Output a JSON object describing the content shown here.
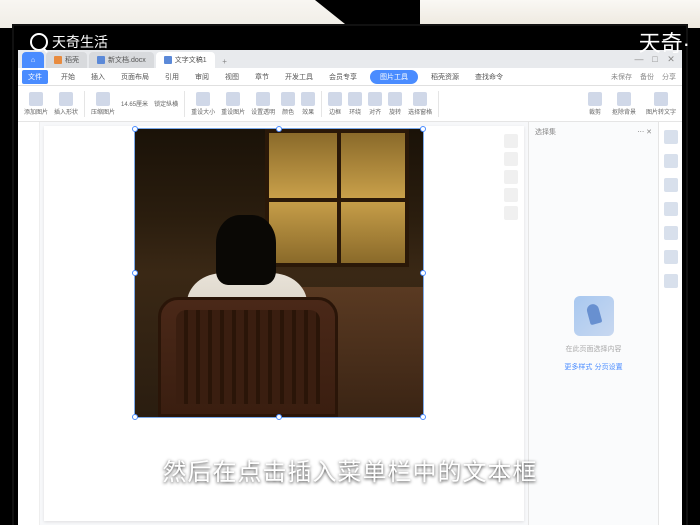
{
  "watermark": {
    "top_left": "天奇生活",
    "top_right": "天奇·"
  },
  "tabs": {
    "home_icon": "⌂",
    "tab1": "稻壳",
    "tab2": "新文档.docx",
    "tab3": "文字文稿1",
    "plus": "+"
  },
  "window_controls": {
    "min": "—",
    "max": "□",
    "close": "✕"
  },
  "menu": {
    "file": "文件",
    "items": [
      "开始",
      "插入",
      "页面布局",
      "引用",
      "审阅",
      "视图",
      "章节",
      "开发工具",
      "会员专享"
    ],
    "active_tool": "图片工具",
    "extra": [
      "稻壳资源",
      "查找命令"
    ],
    "right": [
      "未保存",
      "备份",
      "分享"
    ]
  },
  "ribbon": {
    "groups": [
      "添加图片",
      "插入形状",
      "压缩图片",
      "14.65厘米",
      "锁定纵横",
      "重设大小",
      "重设图片",
      "设置透明",
      "颜色",
      "效果",
      "边框",
      "环绕",
      "对齐",
      "旋转",
      "选择窗格",
      "裁剪",
      "抠除背景",
      "图片转文字"
    ]
  },
  "right_panel": {
    "title": "选择集",
    "hint": "在此页面选择内容",
    "link1": "更多样式",
    "link2": "分页设置"
  },
  "subtitle": "然后在点击插入菜单栏中的文本框"
}
